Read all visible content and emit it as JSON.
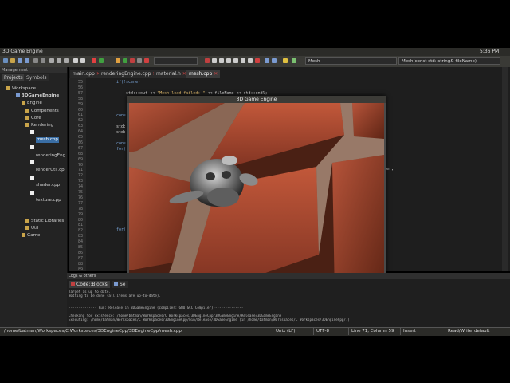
{
  "os": {
    "window_title": "3D Game Engine",
    "clock": "5:36 PM"
  },
  "toolbar": {
    "combo_left": "Mesh",
    "combo_right": "Mesh(const std::string& fileName)"
  },
  "management": {
    "header": "Management",
    "tabs": [
      "Projects",
      "Symbols"
    ],
    "tree": [
      {
        "label": "Workspace",
        "indent": 0
      },
      {
        "label": "3DGameEngine",
        "indent": 1
      },
      {
        "label": "Engine",
        "indent": 2
      },
      {
        "label": "Components",
        "indent": 3
      },
      {
        "label": "Core",
        "indent": 3
      },
      {
        "label": "Rendering",
        "indent": 3
      },
      {
        "label": "mesh.cpp",
        "indent": 4
      },
      {
        "label": "renderingEng",
        "indent": 4
      },
      {
        "label": "renderUtil.cp",
        "indent": 4
      },
      {
        "label": "shader.cpp",
        "indent": 4
      },
      {
        "label": "texture.cpp",
        "indent": 4
      },
      {
        "label": "Static Libraries",
        "indent": 2
      },
      {
        "label": "Util",
        "indent": 2
      },
      {
        "label": "Game",
        "indent": 2
      }
    ]
  },
  "editor": {
    "tabs": [
      "main.cpp",
      "renderingEngine.cpp",
      "material.h",
      "mesh.cpp"
    ],
    "active_tab": 3,
    "line_numbers": [
      "55",
      "56",
      "57",
      "58",
      "59",
      "60",
      "61",
      "62",
      "63",
      "64",
      "65",
      "66",
      "67",
      "68",
      "69",
      "70",
      "71",
      "72",
      "73",
      "74",
      "75",
      "76",
      "77",
      "78",
      "79",
      "80",
      "81",
      "82",
      "83",
      "84",
      "85",
      "86",
      "87",
      "88",
      "89"
    ],
    "code": {
      "line_a": "if(!scene)",
      "line_b_prefix": "std::cout << ",
      "line_b_string": "\"Mesh load failed: \"",
      "line_b_suffix": " << fileName << std::endl;",
      "fragment_const1": "cons",
      "fragment_std1": "std:",
      "fragment_std2": "std:",
      "fragment_const2": "cons",
      "fragment_for1": "for(",
      "fragment_for2": "for(",
      "fragment_right": "er,"
    }
  },
  "game_window": {
    "title": "3D Game Engine"
  },
  "logs": {
    "header": "Logs & others",
    "tabs": [
      "Code::Blocks",
      "Se"
    ],
    "lines": [
      "Target is up to date.",
      "Nothing to be done (all items are up-to-date).",
      "",
      "-------------- Run: Release in 3DGameEngine (compiler: GNU GCC Compiler)---------------",
      "",
      "Checking for existence: /home/batman/Workspaces/C Workspaces/3DEngineCpp/3DGameEngine/Release/3DGameEngine",
      "Executing: /home/batman/Workspaces/C Workspaces/3DEngineCpp/bin/Release/3DGameEngine  (in /home/batman/Workspaces/C Workspaces/3DEngineCpp/.)"
    ]
  },
  "status": {
    "path": "/home/batman/Workspaces/C Workspaces/3DEngineCpp/3DEngineCpp/mesh.cpp",
    "eol": "Unix (LF)",
    "encoding": "UTF-8",
    "position": "Line 71, Column 59",
    "mode": "Insert",
    "access": "Read/Write",
    "profile": "default"
  },
  "colors": {
    "accent": "#3a6ea5",
    "string": "#e8c070",
    "keyword": "#7aa6da",
    "brick": "#8a3a22"
  }
}
